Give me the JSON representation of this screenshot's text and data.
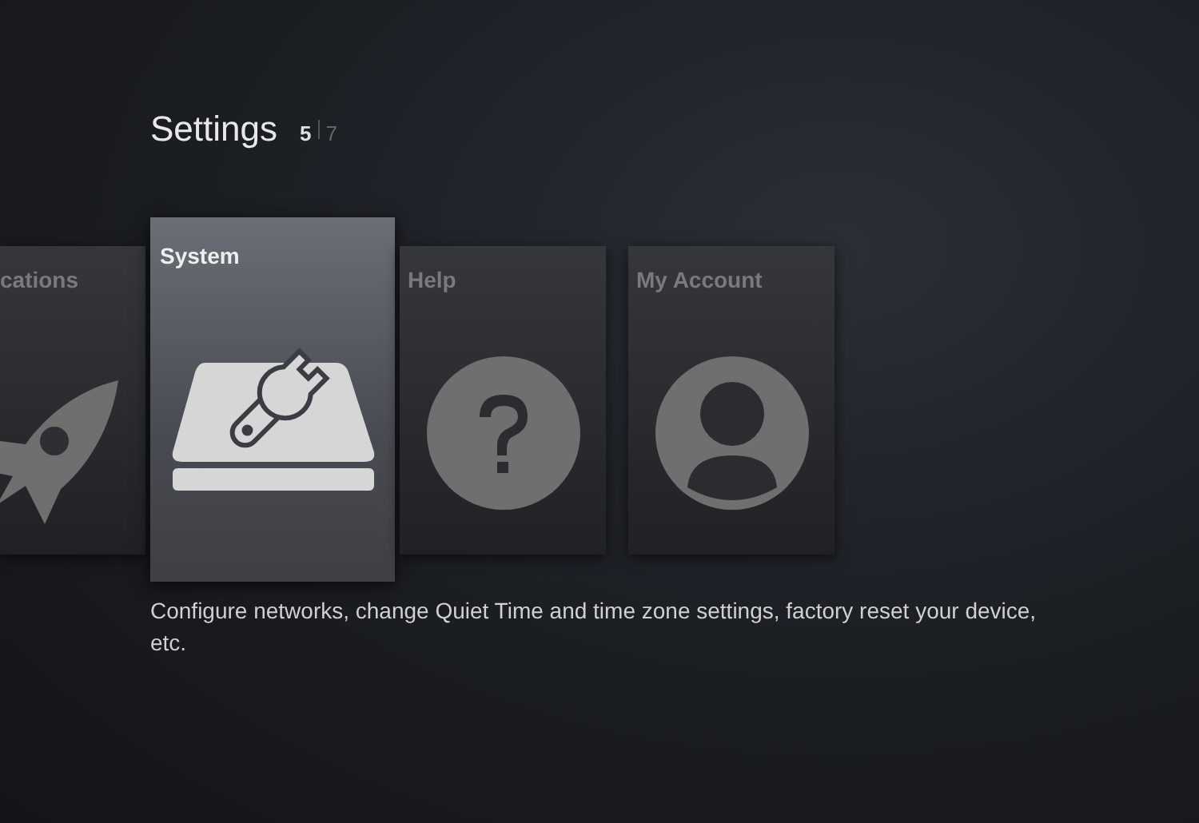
{
  "header": {
    "title": "Settings",
    "current_page": "5",
    "total_pages": "7"
  },
  "cards": [
    {
      "kind": "rocket",
      "label": "cations",
      "selected": false
    },
    {
      "kind": "system",
      "label": "System",
      "selected": true
    },
    {
      "kind": "help",
      "label": "Help",
      "selected": false
    },
    {
      "kind": "account",
      "label": "My Account",
      "selected": false
    }
  ],
  "description": "Configure networks, change Quiet Time and time zone settings, factory reset your device, etc."
}
